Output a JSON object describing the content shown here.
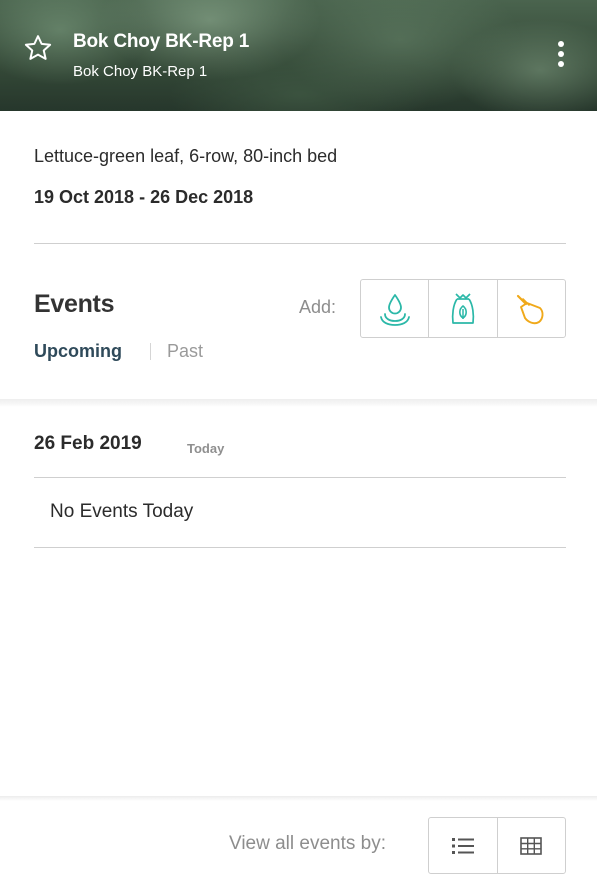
{
  "header": {
    "title": "Bok Choy BK-Rep 1",
    "subtitle": "Bok Choy BK-Rep 1",
    "favorite_icon": "star-outline-icon",
    "menu_icon": "kebab-menu-icon"
  },
  "planting": {
    "crop_description": "Lettuce-green leaf, 6-row, 80-inch bed",
    "date_range": "19 Oct 2018 - 26 Dec 2018"
  },
  "events": {
    "title": "Events",
    "tabs": [
      {
        "label": "Upcoming",
        "active": true
      },
      {
        "label": "Past",
        "active": false
      }
    ],
    "add_label": "Add:",
    "add_buttons": [
      {
        "icon": "water-drop-icon",
        "color": "#2bb8a8"
      },
      {
        "icon": "fertilizer-bag-icon",
        "color": "#2bb8a8"
      },
      {
        "icon": "trowel-icon",
        "color": "#f0a91a"
      }
    ]
  },
  "day": {
    "date": "26 Feb 2019",
    "badge": "Today",
    "empty_message": "No Events Today"
  },
  "footer": {
    "view_label": "View all events by:",
    "view_buttons": [
      {
        "icon": "list-icon"
      },
      {
        "icon": "calendar-grid-icon"
      }
    ]
  },
  "colors": {
    "accent_teal": "#2bb8a8",
    "accent_orange": "#f0a91a",
    "active_tab": "#2f4a5a"
  }
}
